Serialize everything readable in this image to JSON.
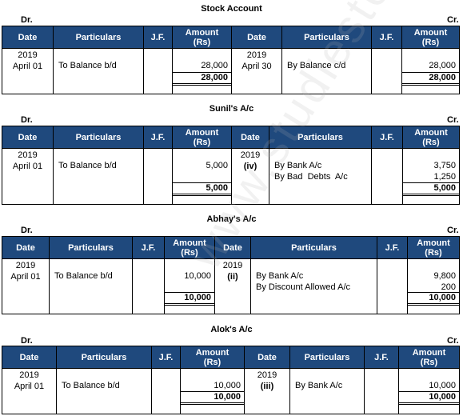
{
  "watermark": "www.studiestoday.com",
  "columns": {
    "date": "Date",
    "particulars": "Particulars",
    "jf": "J.F.",
    "amount_line1": "Amount",
    "amount_line2": "(Rs)"
  },
  "dr_label": "Dr.",
  "cr_label": "Cr.",
  "accounts": [
    {
      "title": "Stock Account",
      "debit": {
        "year": "2019",
        "date": "April 01",
        "entries": [
          {
            "particulars": "To Balance b/d",
            "jf": "",
            "amount": "28,000"
          }
        ],
        "total": "28,000"
      },
      "credit": {
        "year": "2019",
        "date": "April 30",
        "entries": [
          {
            "particulars": "By Balance c/d",
            "jf": "",
            "amount": "28,000"
          }
        ],
        "total": "28,000"
      }
    },
    {
      "title": "Sunil's A/c",
      "debit": {
        "year": "2019",
        "date": "April 01",
        "entries": [
          {
            "particulars": "To Balance b/d",
            "jf": "",
            "amount": "5,000"
          }
        ],
        "total": "5,000"
      },
      "credit": {
        "year": "2019",
        "date": "(iv)",
        "entries": [
          {
            "particulars": "By Bank A/c",
            "jf": "",
            "amount": "3,750"
          },
          {
            "particulars": "By Bad  Debts  A/c",
            "jf": "",
            "amount": "1,250"
          }
        ],
        "total": "5,000"
      }
    },
    {
      "title": "Abhay's A/c",
      "debit": {
        "year": "2019",
        "date": "April 01",
        "entries": [
          {
            "particulars": "To Balance b/d",
            "jf": "",
            "amount": "10,000"
          }
        ],
        "total": "10,000"
      },
      "credit": {
        "year": "2019",
        "date": "(ii)",
        "entries": [
          {
            "particulars": "By Bank A/c",
            "jf": "",
            "amount": "9,800"
          },
          {
            "particulars": "By Discount Allowed A/c",
            "jf": "",
            "amount": "200"
          }
        ],
        "total": "10,000"
      }
    },
    {
      "title": "Alok's A/c",
      "debit": {
        "year": "2019",
        "date": "April 01",
        "entries": [
          {
            "particulars": "To Balance b/d",
            "jf": "",
            "amount": "10,000"
          }
        ],
        "total": "10,000"
      },
      "credit": {
        "year": "2019",
        "date": "(iii)",
        "entries": [
          {
            "particulars": "By Bank A/c",
            "jf": "",
            "amount": "10,000"
          }
        ],
        "total": "10,000"
      }
    }
  ]
}
